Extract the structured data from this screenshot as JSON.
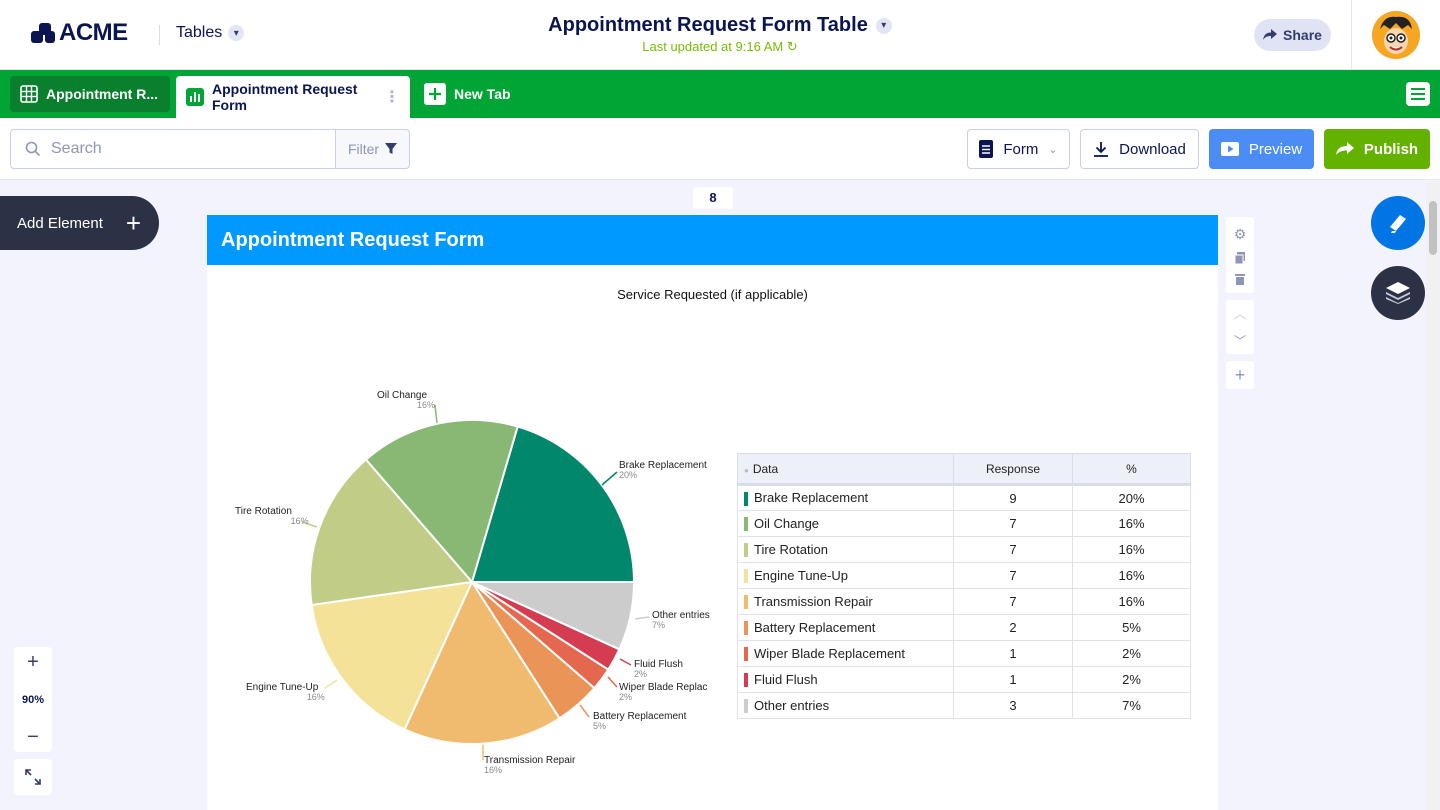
{
  "header": {
    "logo_text": "ACME",
    "tables_label": "Tables",
    "title": "Appointment Request Form Table",
    "subtitle": "Last updated at 9:16 AM",
    "share_label": "Share"
  },
  "tabs": [
    {
      "label": "Appointment R..."
    },
    {
      "label": "Appointment Request Form"
    },
    {
      "label": "New Tab"
    }
  ],
  "toolbar": {
    "search_placeholder": "Search",
    "filter_label": "Filter",
    "form_label": "Form",
    "download_label": "Download",
    "preview_label": "Preview",
    "publish_label": "Publish"
  },
  "canvas": {
    "add_element_label": "Add Element",
    "page_number": "8",
    "zoom_level": "90%"
  },
  "report": {
    "header_title": "Appointment Request Form",
    "table_headers": {
      "data": "Data",
      "response": "Response",
      "pct": "%"
    }
  },
  "colors": {
    "accent_green": "#01a535",
    "brand_navy": "#0a1551",
    "report_blue": "#0099ff",
    "publish_green": "#64b200",
    "preview_blue": "#4c8cf5"
  },
  "chart_data": {
    "type": "pie",
    "title": "Service Requested (if applicable)",
    "slices": [
      {
        "label": "Brake Replacement",
        "value": 9,
        "percent": "20%",
        "color": "#00876c"
      },
      {
        "label": "Oil Change",
        "value": 7,
        "percent": "16%",
        "color": "#89b874"
      },
      {
        "label": "Tire Rotation",
        "value": 7,
        "percent": "16%",
        "color": "#c1cd87"
      },
      {
        "label": "Engine Tune-Up",
        "value": 7,
        "percent": "16%",
        "color": "#f4e298"
      },
      {
        "label": "Transmission Repair",
        "value": 7,
        "percent": "16%",
        "color": "#f0bb6e"
      },
      {
        "label": "Battery Replacement",
        "value": 2,
        "percent": "5%",
        "color": "#ea9458"
      },
      {
        "label": "Wiper Blade Replacement",
        "value": 1,
        "percent": "2%",
        "color": "#e5684e"
      },
      {
        "label": "Fluid Flush",
        "value": 1,
        "percent": "2%",
        "color": "#d43d51"
      },
      {
        "label": "Other entries",
        "value": 3,
        "percent": "7%",
        "color": "#cccccc"
      }
    ],
    "pie_labels": [
      {
        "text": "Oil Change",
        "pct": "16%"
      },
      {
        "text": "Brake Replacement",
        "pct": "20%"
      },
      {
        "text": "Tire Rotation",
        "pct": "16%"
      },
      {
        "text": "Other entries",
        "pct": "7%"
      },
      {
        "text": "Fluid Flush",
        "pct": "2%"
      },
      {
        "text": "Wiper Blade Replac",
        "pct": "2%"
      },
      {
        "text": "Engine Tune-Up",
        "pct": "16%"
      },
      {
        "text": "Battery Replacement",
        "pct": "5%"
      },
      {
        "text": "Transmission Repair",
        "pct": "16%"
      }
    ]
  }
}
